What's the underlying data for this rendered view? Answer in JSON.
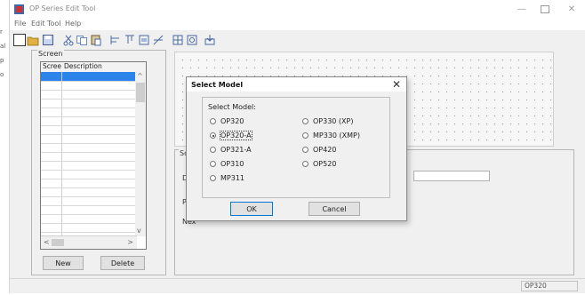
{
  "window": {
    "title": "OP Series Edit Tool"
  },
  "menu": [
    "File",
    "Edit",
    "Tool",
    "Help"
  ],
  "screen_panel": {
    "legend": "Screen",
    "columns": [
      "Scree",
      "Description"
    ],
    "new_label": "New",
    "delete_label": "Delete"
  },
  "properties": {
    "legend": "Screen",
    "desc_label": "Des",
    "prev_label": "Pre",
    "next_label": "Nex"
  },
  "status": {
    "model": "OP320"
  },
  "dialog": {
    "title": "Select Model",
    "group_label": "Select Model:",
    "options_left": [
      "OP320",
      "OP320-A",
      "OP321-A",
      "OP310",
      "MP311"
    ],
    "options_right": [
      "OP330 (XP)",
      "MP330 (XMP)",
      "OP420",
      "OP520"
    ],
    "selected": "OP320-A",
    "ok_label": "OK",
    "cancel_label": "Cancel"
  },
  "colors": {
    "selection": "#2c84ea",
    "window_bg": "#f0f0f0"
  }
}
